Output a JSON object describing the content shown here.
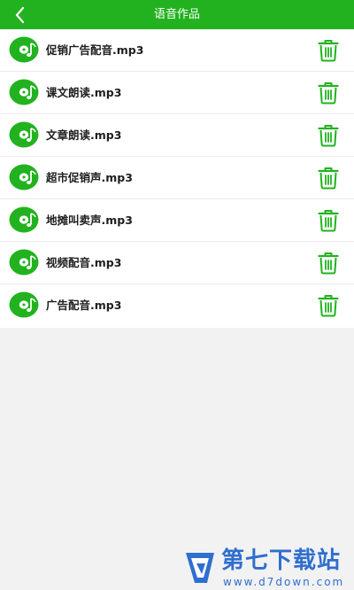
{
  "header": {
    "title": "语音作品",
    "back_icon": "chevron-left-icon"
  },
  "items": [
    {
      "name": "促销广告配音.mp3"
    },
    {
      "name": "课文朗读.mp3"
    },
    {
      "name": "文章朗读.mp3"
    },
    {
      "name": "超市促销声.mp3"
    },
    {
      "name": "地摊叫卖声.mp3"
    },
    {
      "name": "视频配音.mp3"
    },
    {
      "name": "广告配音.mp3"
    }
  ],
  "icons": {
    "item": "music-disc-icon",
    "delete": "trash-icon"
  },
  "colors": {
    "header_bg": "#22b21f",
    "accent": "#22b21f",
    "page_bg": "#f2f2f2",
    "watermark": "#2f6fcf"
  },
  "watermark": {
    "title": "第七下载站",
    "url": "www.d7down.com"
  }
}
